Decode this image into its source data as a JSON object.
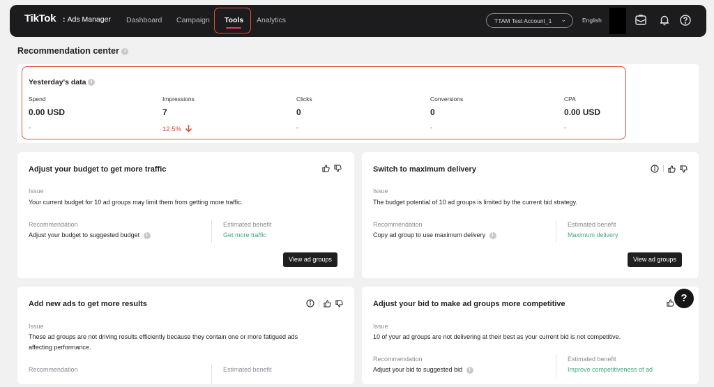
{
  "header": {
    "logo": "TikTok",
    "logo_suffix": ":",
    "product": "Ads Manager",
    "nav": [
      "Dashboard",
      "Campaign",
      "Tools",
      "Analytics"
    ],
    "active_nav": "Tools",
    "account": "TTAM Test Account_1",
    "language": "English",
    "icons": [
      "briefcase-icon",
      "bell-icon",
      "help-icon"
    ]
  },
  "page": {
    "title": "Recommendation center"
  },
  "yesterday": {
    "title": "Yesterday's data",
    "metrics": [
      {
        "label": "Spend",
        "value": "0.00 USD",
        "change": "-"
      },
      {
        "label": "Impressions",
        "value": "7",
        "change": "12.5%"
      },
      {
        "label": "Clicks",
        "value": "0",
        "change": "-"
      },
      {
        "label": "Conversions",
        "value": "0",
        "change": "-"
      },
      {
        "label": "CPA",
        "value": "0.00 USD",
        "change": "-"
      }
    ]
  },
  "cards": [
    {
      "title": "Adjust your budget to get more traffic",
      "issue_label": "Issue",
      "issue": "Your current budget for 10 ad groups may limit them from getting more traffic.",
      "rec_label": "Recommendation",
      "rec": "Adjust your budget to suggested budget",
      "ben_label": "Estimated benefit",
      "ben": "Get more traffic",
      "button": "View ad groups"
    },
    {
      "title": "Switch to maximum delivery",
      "issue_label": "Issue",
      "issue": "The budget potential of 10 ad groups is limited by the current bid strategy.",
      "rec_label": "Recommendation",
      "rec": "Copy ad group to use maximum delivery",
      "ben_label": "Estimated benefit",
      "ben": "Maximum delivery",
      "button": "View ad groups"
    },
    {
      "title": "Add new ads to get more results",
      "issue_label": "Issue",
      "issue_line1": "These ad groups are not driving results efficiently because they contain one or more fatigued ads",
      "issue_line2": "affecting performance.",
      "rec_label": "Recommendation",
      "ben_label": "Estimated benefit"
    },
    {
      "title": "Adjust your bid to make ad groups more competitive",
      "issue_label": "Issue",
      "issue": "10 of your ad groups are not delivering at their best as your current bid is not competitive.",
      "rec_label": "Recommendation",
      "rec": "Adjust your bid to suggested bid",
      "ben_label": "Estimated benefit",
      "ben": "Improve competitiveness of ad"
    }
  ],
  "help_fab": "?",
  "colors": {
    "accent_red": "#fe2c55",
    "highlight": "#e0503a",
    "benefit_green": "#3fa97c",
    "decrease": "#c8553d"
  }
}
